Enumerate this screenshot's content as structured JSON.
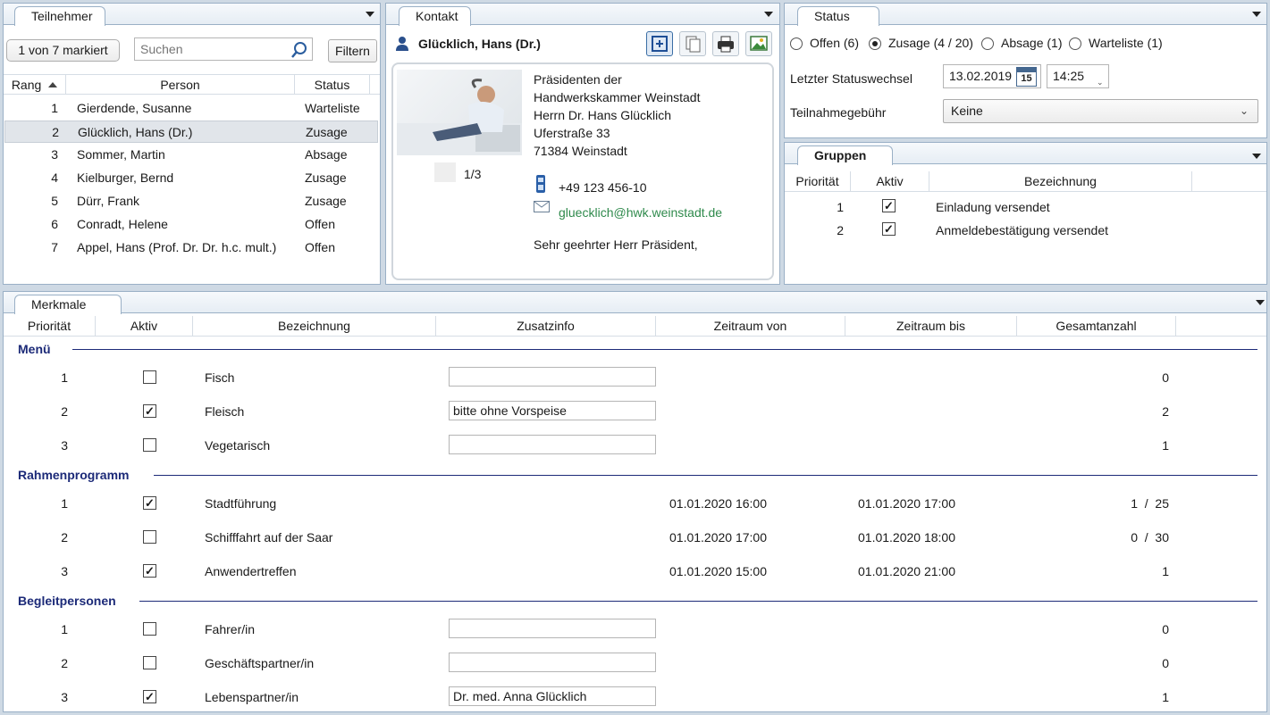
{
  "teilnehmer": {
    "tab": "Teilnehmer",
    "marked": "1 von 7 markiert",
    "search_placeholder": "Suchen",
    "filter": "Filtern",
    "columns": [
      "Rang",
      "Person",
      "Status"
    ],
    "rows": [
      {
        "rang": "1",
        "person": "Gierdende, Susanne",
        "status": "Warteliste"
      },
      {
        "rang": "2",
        "person": "Glücklich, Hans (Dr.)",
        "status": "Zusage"
      },
      {
        "rang": "3",
        "person": "Sommer, Martin",
        "status": "Absage"
      },
      {
        "rang": "4",
        "person": "Kielburger, Bernd",
        "status": "Zusage"
      },
      {
        "rang": "5",
        "person": "Dürr, Frank",
        "status": "Zusage"
      },
      {
        "rang": "6",
        "person": "Conradt, Helene",
        "status": "Offen"
      },
      {
        "rang": "7",
        "person": "Appel, Hans (Prof. Dr. Dr. h.c. mult.)",
        "status": "Offen"
      }
    ],
    "selected_index": 1
  },
  "kontakt": {
    "tab": "Kontakt",
    "name": "Glücklich, Hans (Dr.)",
    "address": [
      "Präsidenten der",
      "Handwerkskammer Weinstadt",
      "Herrn Dr. Hans Glücklich",
      "Uferstraße 33",
      "71384 Weinstadt"
    ],
    "photo_counter": "1/3",
    "phone": "+49 123 456-10",
    "email": "gluecklich@hwk.weinstadt.de",
    "salutation": "Sehr geehrter Herr Präsident,",
    "icons": [
      "add-contact-icon",
      "copy-icon",
      "print-icon",
      "image-icon"
    ]
  },
  "status": {
    "tab": "Status",
    "options": [
      {
        "label": "Offen (6)",
        "selected": false
      },
      {
        "label": "Zusage (4 / 20)",
        "selected": true
      },
      {
        "label": "Absage (1)",
        "selected": false
      },
      {
        "label": "Warteliste (1)",
        "selected": false
      }
    ],
    "last_change_label": "Letzter Statuswechsel",
    "last_change_date": "13.02.2019",
    "calendar_day": "15",
    "last_change_time": "14:25",
    "fee_label": "Teilnahmegebühr",
    "fee_value": "Keine"
  },
  "gruppen": {
    "tab": "Gruppen",
    "columns": [
      "Priorität",
      "Aktiv",
      "Bezeichnung"
    ],
    "rows": [
      {
        "prio": "1",
        "aktiv": true,
        "bez": "Einladung versendet"
      },
      {
        "prio": "2",
        "aktiv": true,
        "bez": "Anmeldebestätigung versendet"
      }
    ]
  },
  "merkmale": {
    "tab": "Merkmale",
    "columns": [
      "Priorität",
      "Aktiv",
      "Bezeichnung",
      "Zusatzinfo",
      "Zeitraum von",
      "Zeitraum bis",
      "Gesamtanzahl"
    ],
    "groups": [
      {
        "title": "Menü",
        "rows": [
          {
            "prio": "1",
            "aktiv": false,
            "bez": "Fisch",
            "zusatz": "",
            "has_input": true,
            "von": "",
            "bis": "",
            "anzahl": "0"
          },
          {
            "prio": "2",
            "aktiv": true,
            "bez": "Fleisch",
            "zusatz": "bitte ohne Vorspeise",
            "has_input": true,
            "von": "",
            "bis": "",
            "anzahl": "2"
          },
          {
            "prio": "3",
            "aktiv": false,
            "bez": "Vegetarisch",
            "zusatz": "",
            "has_input": true,
            "von": "",
            "bis": "",
            "anzahl": "1"
          }
        ]
      },
      {
        "title": "Rahmenprogramm",
        "rows": [
          {
            "prio": "1",
            "aktiv": true,
            "bez": "Stadtführung",
            "zusatz": "",
            "has_input": false,
            "von": "01.01.2020 16:00",
            "bis": "01.01.2020 17:00",
            "anzahl": "1  /  25"
          },
          {
            "prio": "2",
            "aktiv": false,
            "bez": "Schifffahrt auf der Saar",
            "zusatz": "",
            "has_input": false,
            "von": "01.01.2020 17:00",
            "bis": "01.01.2020 18:00",
            "anzahl": "0  /  30"
          },
          {
            "prio": "3",
            "aktiv": true,
            "bez": "Anwendertreffen",
            "zusatz": "",
            "has_input": false,
            "von": "01.01.2020 15:00",
            "bis": "01.01.2020 21:00",
            "anzahl": "1"
          }
        ]
      },
      {
        "title": "Begleitpersonen",
        "rows": [
          {
            "prio": "1",
            "aktiv": false,
            "bez": "Fahrer/in",
            "zusatz": "",
            "has_input": true,
            "von": "",
            "bis": "",
            "anzahl": "0"
          },
          {
            "prio": "2",
            "aktiv": false,
            "bez": "Geschäftspartner/in",
            "zusatz": "",
            "has_input": true,
            "von": "",
            "bis": "",
            "anzahl": "0"
          },
          {
            "prio": "3",
            "aktiv": true,
            "bez": "Lebenspartner/in",
            "zusatz": "Dr. med. Anna Glücklich",
            "has_input": true,
            "von": "",
            "bis": "",
            "anzahl": "1"
          }
        ]
      }
    ]
  }
}
